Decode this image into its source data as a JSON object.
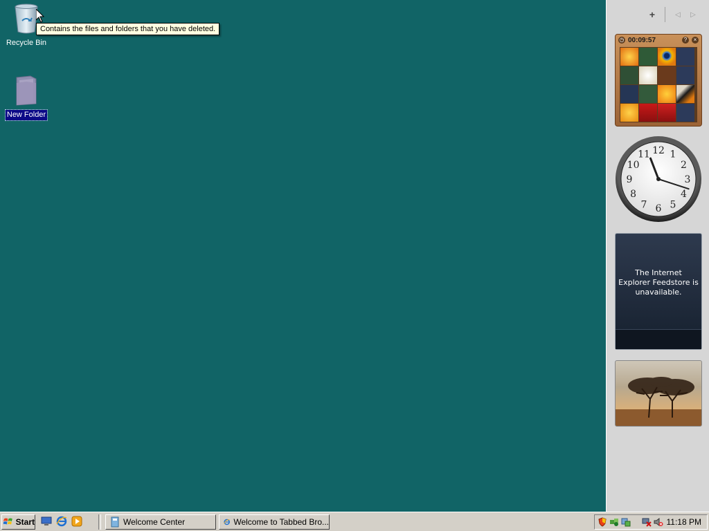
{
  "desktop": {
    "background": "#116466",
    "icons": [
      {
        "label": "Recycle Bin",
        "icon": "recycle-bin-icon"
      },
      {
        "label": "New Folder",
        "icon": "folder-icon",
        "selected": true
      }
    ],
    "tooltip": "Contains the files and folders that you have deleted."
  },
  "sidebar": {
    "add_gadget": "+",
    "prev": "◁",
    "next": "▷",
    "puzzle": {
      "timer": "00:09:57",
      "help": "?",
      "close": "×"
    },
    "clock": {
      "numerals": [
        "12",
        "1",
        "2",
        "3",
        "4",
        "5",
        "6",
        "7",
        "8",
        "9",
        "10",
        "11"
      ],
      "time_shown": "11:18"
    },
    "feed": {
      "message": "The Internet Explorer Feedstore is unavailable."
    },
    "slideshow": {
      "image": "trees-at-sunset"
    }
  },
  "taskbar": {
    "start_label": "Start",
    "quick_launch": [
      "show-desktop-icon",
      "internet-explorer-icon",
      "media-player-icon"
    ],
    "tasks": [
      {
        "label": "Welcome Center",
        "icon": "welcome-center-icon"
      },
      {
        "label": "Welcome to Tabbed Bro...",
        "icon": "internet-explorer-icon"
      }
    ],
    "tray_icons": [
      "security-shield-icon",
      "network-icon",
      "sync-icon",
      "network-disconnected-icon",
      "volume-muted-icon"
    ],
    "clock": "11:18 PM"
  }
}
